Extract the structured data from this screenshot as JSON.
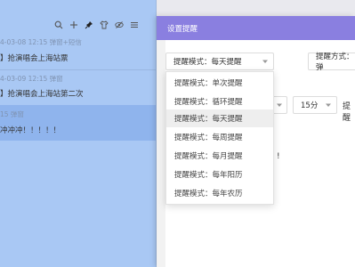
{
  "colors": {
    "list_background": "#a9c8f4",
    "selected_row": "#8fb4ed",
    "dialog_header": "#8a7fe0"
  },
  "toolbar": {
    "icons": [
      "search-icon",
      "plus-icon",
      "pin-icon",
      "shirt-icon",
      "eye-icon",
      "menu-icon"
    ]
  },
  "notes": [
    {
      "meta": "4-03-08 12:15  弹窗+短信",
      "title": "】抢演唱会上海站票"
    },
    {
      "meta": "4-03-09 12:15  弹窗",
      "title": "】抢演唱会上海站第二次"
    },
    {
      "meta": "15  弹窗",
      "title": "冲冲冲！！！！！"
    }
  ],
  "dialog": {
    "title": "设置提醒",
    "mode_select": "提醒模式：每天提醒",
    "method_label": "提醒方式：弹",
    "minute_select": "15分",
    "partial_label": "提醒",
    "exclaim": "!"
  },
  "dropdown": {
    "options": [
      "提醒模式：单次提醒",
      "提醒模式：循环提醒",
      "提醒模式：每天提醒",
      "提醒模式：每周提醒",
      "提醒模式：每月提醒",
      "提醒模式：每年阳历",
      "提醒模式：每年农历"
    ],
    "highlighted": "提醒模式：每天提醒"
  }
}
